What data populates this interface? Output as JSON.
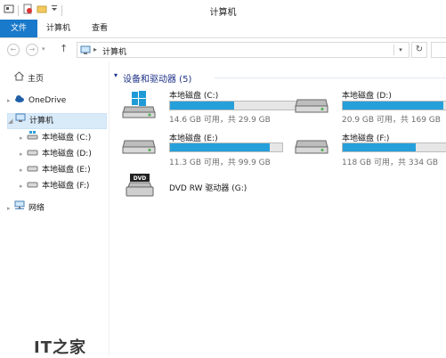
{
  "window": {
    "title": "计算机"
  },
  "ribbon": {
    "tabs": [
      "文件",
      "计算机",
      "查看"
    ]
  },
  "address": {
    "path": "计算机"
  },
  "sidebar": {
    "items": [
      {
        "label": "主页",
        "icon": "home-icon"
      },
      {
        "label": "OneDrive",
        "icon": "cloud-icon"
      },
      {
        "label": "计算机",
        "icon": "computer-icon"
      },
      {
        "label": "本地磁盘 (C:)",
        "icon": "windows-drive-icon"
      },
      {
        "label": "本地磁盘 (D:)",
        "icon": "drive-icon"
      },
      {
        "label": "本地磁盘 (E:)",
        "icon": "drive-icon"
      },
      {
        "label": "本地磁盘 (F:)",
        "icon": "drive-icon"
      },
      {
        "label": "网络",
        "icon": "network-icon"
      }
    ]
  },
  "content": {
    "group_label": "设备和驱动器 (5)",
    "drives": [
      {
        "name": "本地磁盘 (C:)",
        "free": "14.6 GB 可用，共 29.9 GB",
        "used_fraction": 0.51,
        "icon": "windows-drive-icon"
      },
      {
        "name": "本地磁盘 (D:)",
        "free": "20.9 GB 可用，共 169 GB",
        "used_fraction": 0.88,
        "icon": "drive-icon"
      },
      {
        "name": "本地磁盘 (E:)",
        "free": "11.3 GB 可用，共 99.9 GB",
        "used_fraction": 0.89,
        "icon": "drive-icon"
      },
      {
        "name": "本地磁盘 (F:)",
        "free": "118 GB 可用，共 334 GB",
        "used_fraction": 0.65,
        "icon": "drive-icon"
      },
      {
        "name": "DVD RW 驱动器 (G:)",
        "icon": "dvd-drive-icon"
      }
    ]
  },
  "watermark": {
    "text": "IT之家"
  },
  "colors": {
    "accent": "#1979ca",
    "bar": "#26a0da",
    "selection": "#d9eaf9"
  }
}
